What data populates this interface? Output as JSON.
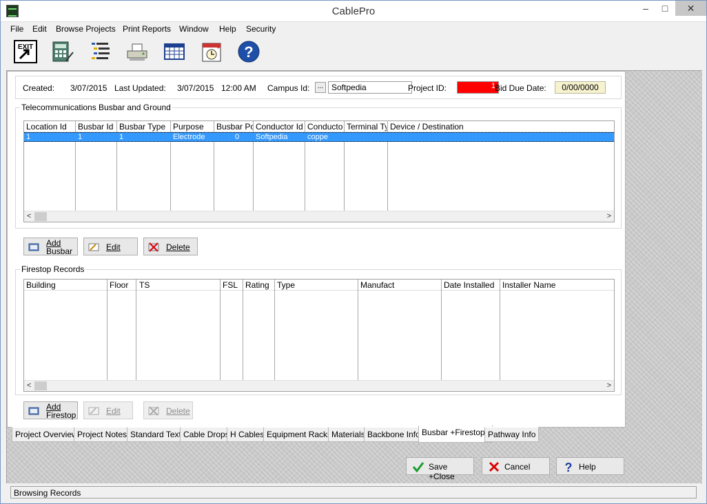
{
  "window": {
    "title": "CablePro",
    "minimize_glyph": "–",
    "maximize_glyph": "□",
    "close_glyph": "✕"
  },
  "menu": [
    "File",
    "Edit",
    "Browse Projects",
    "Print Reports",
    "Window",
    "Help",
    "Security"
  ],
  "toolbar": {
    "icons": [
      "exit-icon",
      "calculator-icon",
      "list-icon",
      "printer-icon",
      "spreadsheet-icon",
      "calendar-icon",
      "help-icon"
    ],
    "exit_label": "EXIT"
  },
  "header": {
    "created_label": "Created:",
    "created_value": "3/07/2015",
    "updated_label": "Last Updated:",
    "updated_date": "3/07/2015",
    "updated_time": "12:00 AM",
    "campus_label": "Campus Id:",
    "campus_button": "...",
    "campus_value": "Softpedia",
    "project_label": "Project ID:",
    "project_value": "1",
    "bid_label": "Bid Due Date:",
    "bid_value": "0/00/0000"
  },
  "busbar": {
    "title": "Telecommunications Busbar and Ground",
    "columns": [
      "Location Id",
      "Busbar Id",
      "Busbar Type",
      "Purpose",
      "Busbar Po:",
      "Conductor Id",
      "Conductor",
      "Terminal Typ",
      "Device / Destination"
    ],
    "rows": [
      [
        "1",
        "1",
        "1",
        "Electrode",
        "0",
        "Softpedia",
        "coppe",
        "",
        ""
      ]
    ],
    "buttons": {
      "add_line1": "Add",
      "add_line2": "Busbar",
      "edit": "Edit",
      "delete": "Delete"
    }
  },
  "firestop": {
    "title": "Firestop Records",
    "columns": [
      "Building",
      "Floor",
      "TS",
      "FSL",
      "Rating",
      "Type",
      "Manufact",
      "Date Installed",
      "Installer Name"
    ],
    "buttons": {
      "add_line1": "Add",
      "add_line2": "Firestop",
      "edit": "Edit",
      "delete": "Delete"
    }
  },
  "scroll": {
    "left": "<",
    "right": ">"
  },
  "tabs": [
    "Project Overview",
    "Project Notes:",
    "Standard Text",
    "Cable Drops",
    "H Cables",
    "Equipment Racks",
    "Materials",
    "Backbone Info",
    "Busbar +Firestops",
    "Pathway Info"
  ],
  "active_tab": "Busbar +Firestops",
  "footer": {
    "save": "Save +Close",
    "cancel": "Cancel",
    "help": "Help"
  },
  "status": "Browsing Records",
  "colors": {
    "selection": "#3399ff",
    "project_id_bg": "#ff0000",
    "bid_bg": "#f7f3cf"
  }
}
